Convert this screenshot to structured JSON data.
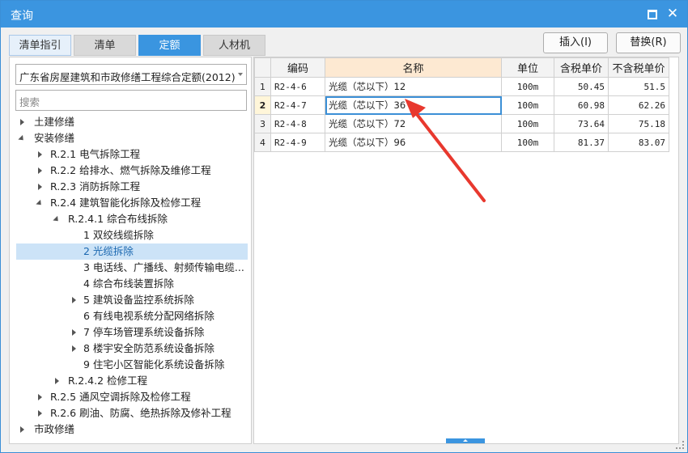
{
  "window": {
    "title": "查询"
  },
  "tabs": [
    "清单指引",
    "清单",
    "定额",
    "人材机"
  ],
  "buttons": {
    "insert": "插入(I)",
    "replace": "替换(R)"
  },
  "quota_library": {
    "selected": "广东省房屋建筑和市政修缮工程综合定额(2012)"
  },
  "search": {
    "placeholder": "搜索"
  },
  "tree": [
    {
      "label": "土建修缮",
      "expander": "right"
    },
    {
      "label": "安装修缮",
      "expander": "down"
    },
    {
      "label": "R.2.1 电气拆除工程",
      "expander": "right"
    },
    {
      "label": "R.2.2 给排水、燃气拆除及维修工程",
      "expander": "right"
    },
    {
      "label": "R.2.3 消防拆除工程",
      "expander": "right"
    },
    {
      "label": "R.2.4 建筑智能化拆除及检修工程",
      "expander": "down"
    },
    {
      "label": "R.2.4.1 综合布线拆除",
      "expander": "down"
    },
    {
      "label": "1 双绞线缆拆除",
      "expander": ""
    },
    {
      "label": "2 光缆拆除",
      "expander": "",
      "selected": true
    },
    {
      "label": "3 电话线、广播线、射频传输电缆...",
      "expander": ""
    },
    {
      "label": "4 综合布线装置拆除",
      "expander": ""
    },
    {
      "label": "5 建筑设备监控系统拆除",
      "expander": "right"
    },
    {
      "label": "6 有线电视系统分配网络拆除",
      "expander": ""
    },
    {
      "label": "7 停车场管理系统设备拆除",
      "expander": "right"
    },
    {
      "label": "8 楼宇安全防范系统设备拆除",
      "expander": "right"
    },
    {
      "label": "9 住宅小区智能化系统设备拆除",
      "expander": ""
    },
    {
      "label": "R.2.4.2 检修工程",
      "expander": "right"
    },
    {
      "label": "R.2.5 通风空调拆除及检修工程",
      "expander": "right"
    },
    {
      "label": "R.2.6 刷油、防腐、绝热拆除及修补工程",
      "expander": "right"
    },
    {
      "label": "市政修缮",
      "expander": "right"
    }
  ],
  "grid": {
    "columns": [
      "编码",
      "名称",
      "单位",
      "含税单价",
      "不含税单价"
    ],
    "rows": [
      {
        "n": "1",
        "code": "R2-4-6",
        "name": "光缆（芯以下）12",
        "unit": "100m",
        "tax": "50.45",
        "notax": "51.5"
      },
      {
        "n": "2",
        "code": "R2-4-7",
        "name": "光缆（芯以下）36",
        "unit": "100m",
        "tax": "60.98",
        "notax": "62.26"
      },
      {
        "n": "3",
        "code": "R2-4-8",
        "name": "光缆（芯以下）72",
        "unit": "100m",
        "tax": "73.64",
        "notax": "75.18"
      },
      {
        "n": "4",
        "code": "R2-4-9",
        "name": "光缆（芯以下）96",
        "unit": "100m",
        "tax": "81.37",
        "notax": "83.07"
      }
    ]
  },
  "colors": {
    "accent": "#3b95e0",
    "selection": "#cce3f7",
    "annotation_arrow": "#e8382e"
  }
}
